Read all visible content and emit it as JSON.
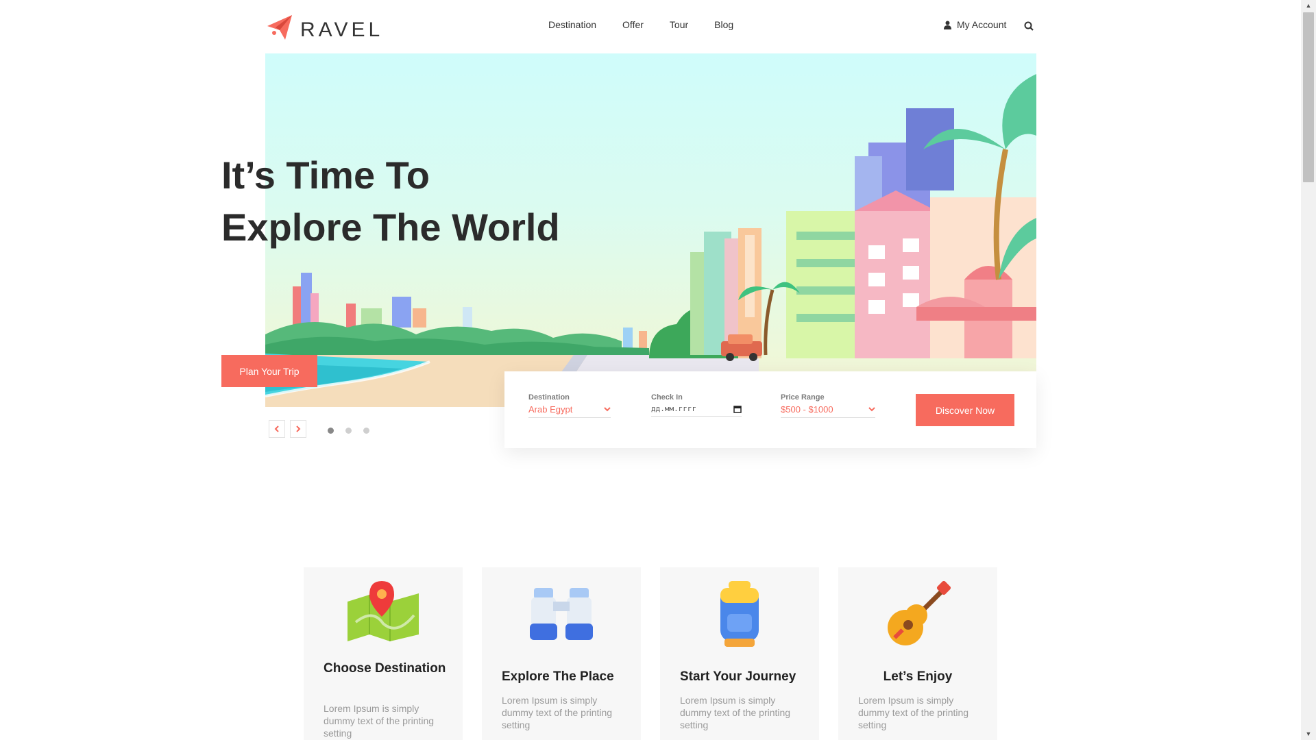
{
  "brand": {
    "logo_text": "RAVEL",
    "accent_color": "#f76b5e"
  },
  "nav": {
    "items": [
      "Destination",
      "Offer",
      "Tour",
      "Blog"
    ]
  },
  "account": {
    "label": "My Account",
    "icon": "user-icon"
  },
  "search_icon": "search-icon",
  "hero": {
    "title_line1": "It’s Time To",
    "title_line2": "Explore The World",
    "cta_label": "Plan Your Trip",
    "prev_icon": "chevron-left-icon",
    "next_icon": "chevron-right-icon",
    "slides_total": 3,
    "active_slide": 1
  },
  "search": {
    "destination_label": "Destination",
    "destination_value": "Arab Egypt",
    "checkin_label": "Check In",
    "checkin_placeholder": "дд.мм.гггг",
    "price_label": "Price Range",
    "price_value": "$500 - $1000",
    "submit_label": "Discover Now"
  },
  "features": [
    {
      "title": "Choose Destination",
      "desc": "Lorem Ipsum is simply dummy text of the printing setting",
      "icon": "map-pin-icon"
    },
    {
      "title": "Explore The Place",
      "desc": "Lorem Ipsum is simply dummy text of the printing setting",
      "icon": "binoculars-icon"
    },
    {
      "title": "Start Your Journey",
      "desc": "Lorem Ipsum is simply dummy text of the printing setting",
      "icon": "backpack-icon"
    },
    {
      "title": "Let’s Enjoy",
      "desc": "Lorem Ipsum is simply dummy text of the printing setting",
      "icon": "guitar-icon"
    }
  ]
}
